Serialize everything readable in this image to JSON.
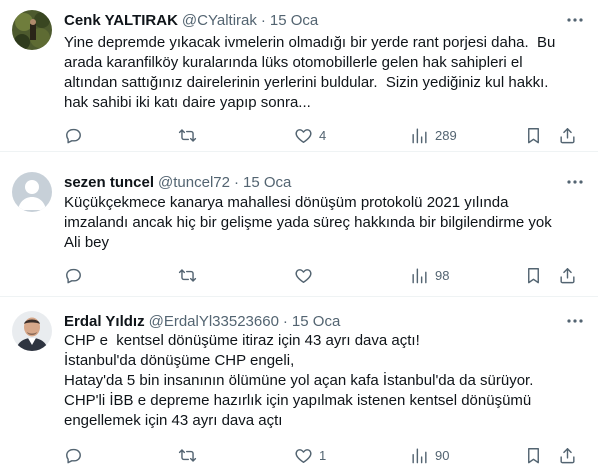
{
  "colors": {
    "text": "#0f1419",
    "secondary": "#536471",
    "divider": "#eff3f4"
  },
  "tweets": [
    {
      "name": "Cenk YALTIRAK",
      "handle": "@CYaltirak",
      "separator": "·",
      "date": "15 Oca",
      "lines": [
        "Yine depremde yıkacak ivmelerin olmadığı bir yerde rant porjesi daha.  Bu",
        "arada karanfilköy kuralarında lüks otomobillerle gelen hak sahipleri el",
        "altından sattığınız dairelerinin yerlerini buldular.  Sizin yediğiniz kul hakkı.",
        "hak sahibi iki katı daire yapıp sonra..."
      ],
      "replies": "",
      "retweets": "",
      "likes": "4",
      "views": "289"
    },
    {
      "name": "sezen tuncel",
      "handle": "@tuncel72",
      "separator": "·",
      "date": "15 Oca",
      "lines": [
        "Küçükçekmece kanarya mahallesi dönüşüm protokolü 2021 yılında",
        "imzalandı ancak hiç bir gelişme yada süreç hakkında bir bilgilendirme yok",
        "Ali bey"
      ],
      "replies": "",
      "retweets": "",
      "likes": "",
      "views": "98"
    },
    {
      "name": "Erdal Yıldız",
      "handle": "@ErdalYl33523660",
      "separator": "·",
      "date": "15 Oca",
      "lines": [
        "CHP e  kentsel dönüşüme itiraz için 43 ayrı dava açtı!",
        "İstanbul'da dönüşüme CHP engeli,",
        "Hatay'da 5 bin insanının ölümüne yol açan kafa İstanbul'da da sürüyor.",
        "CHP'li İBB e depreme hazırlık için yapılmak istenen kentsel dönüşümü",
        "engellemek için 43 ayrı dava açtı"
      ],
      "replies": "",
      "retweets": "",
      "likes": "1",
      "views": "90"
    }
  ]
}
